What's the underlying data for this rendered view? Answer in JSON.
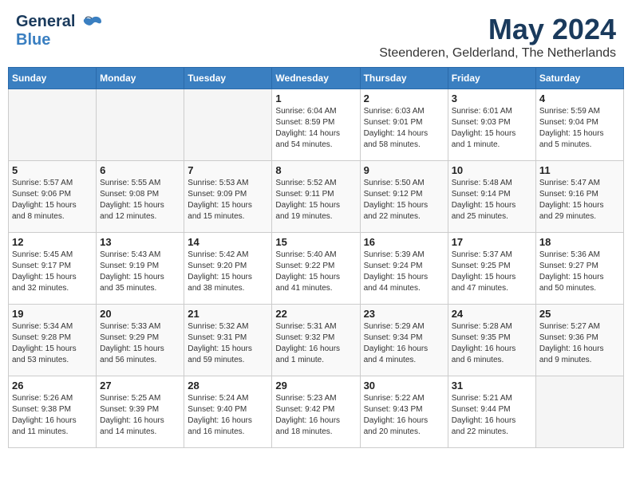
{
  "header": {
    "logo_general": "General",
    "logo_blue": "Blue",
    "title": "May 2024",
    "location": "Steenderen, Gelderland, The Netherlands"
  },
  "weekdays": [
    "Sunday",
    "Monday",
    "Tuesday",
    "Wednesday",
    "Thursday",
    "Friday",
    "Saturday"
  ],
  "weeks": [
    [
      {
        "day": "",
        "info": ""
      },
      {
        "day": "",
        "info": ""
      },
      {
        "day": "",
        "info": ""
      },
      {
        "day": "1",
        "info": "Sunrise: 6:04 AM\nSunset: 8:59 PM\nDaylight: 14 hours\nand 54 minutes."
      },
      {
        "day": "2",
        "info": "Sunrise: 6:03 AM\nSunset: 9:01 PM\nDaylight: 14 hours\nand 58 minutes."
      },
      {
        "day": "3",
        "info": "Sunrise: 6:01 AM\nSunset: 9:03 PM\nDaylight: 15 hours\nand 1 minute."
      },
      {
        "day": "4",
        "info": "Sunrise: 5:59 AM\nSunset: 9:04 PM\nDaylight: 15 hours\nand 5 minutes."
      }
    ],
    [
      {
        "day": "5",
        "info": "Sunrise: 5:57 AM\nSunset: 9:06 PM\nDaylight: 15 hours\nand 8 minutes."
      },
      {
        "day": "6",
        "info": "Sunrise: 5:55 AM\nSunset: 9:08 PM\nDaylight: 15 hours\nand 12 minutes."
      },
      {
        "day": "7",
        "info": "Sunrise: 5:53 AM\nSunset: 9:09 PM\nDaylight: 15 hours\nand 15 minutes."
      },
      {
        "day": "8",
        "info": "Sunrise: 5:52 AM\nSunset: 9:11 PM\nDaylight: 15 hours\nand 19 minutes."
      },
      {
        "day": "9",
        "info": "Sunrise: 5:50 AM\nSunset: 9:12 PM\nDaylight: 15 hours\nand 22 minutes."
      },
      {
        "day": "10",
        "info": "Sunrise: 5:48 AM\nSunset: 9:14 PM\nDaylight: 15 hours\nand 25 minutes."
      },
      {
        "day": "11",
        "info": "Sunrise: 5:47 AM\nSunset: 9:16 PM\nDaylight: 15 hours\nand 29 minutes."
      }
    ],
    [
      {
        "day": "12",
        "info": "Sunrise: 5:45 AM\nSunset: 9:17 PM\nDaylight: 15 hours\nand 32 minutes."
      },
      {
        "day": "13",
        "info": "Sunrise: 5:43 AM\nSunset: 9:19 PM\nDaylight: 15 hours\nand 35 minutes."
      },
      {
        "day": "14",
        "info": "Sunrise: 5:42 AM\nSunset: 9:20 PM\nDaylight: 15 hours\nand 38 minutes."
      },
      {
        "day": "15",
        "info": "Sunrise: 5:40 AM\nSunset: 9:22 PM\nDaylight: 15 hours\nand 41 minutes."
      },
      {
        "day": "16",
        "info": "Sunrise: 5:39 AM\nSunset: 9:24 PM\nDaylight: 15 hours\nand 44 minutes."
      },
      {
        "day": "17",
        "info": "Sunrise: 5:37 AM\nSunset: 9:25 PM\nDaylight: 15 hours\nand 47 minutes."
      },
      {
        "day": "18",
        "info": "Sunrise: 5:36 AM\nSunset: 9:27 PM\nDaylight: 15 hours\nand 50 minutes."
      }
    ],
    [
      {
        "day": "19",
        "info": "Sunrise: 5:34 AM\nSunset: 9:28 PM\nDaylight: 15 hours\nand 53 minutes."
      },
      {
        "day": "20",
        "info": "Sunrise: 5:33 AM\nSunset: 9:29 PM\nDaylight: 15 hours\nand 56 minutes."
      },
      {
        "day": "21",
        "info": "Sunrise: 5:32 AM\nSunset: 9:31 PM\nDaylight: 15 hours\nand 59 minutes."
      },
      {
        "day": "22",
        "info": "Sunrise: 5:31 AM\nSunset: 9:32 PM\nDaylight: 16 hours\nand 1 minute."
      },
      {
        "day": "23",
        "info": "Sunrise: 5:29 AM\nSunset: 9:34 PM\nDaylight: 16 hours\nand 4 minutes."
      },
      {
        "day": "24",
        "info": "Sunrise: 5:28 AM\nSunset: 9:35 PM\nDaylight: 16 hours\nand 6 minutes."
      },
      {
        "day": "25",
        "info": "Sunrise: 5:27 AM\nSunset: 9:36 PM\nDaylight: 16 hours\nand 9 minutes."
      }
    ],
    [
      {
        "day": "26",
        "info": "Sunrise: 5:26 AM\nSunset: 9:38 PM\nDaylight: 16 hours\nand 11 minutes."
      },
      {
        "day": "27",
        "info": "Sunrise: 5:25 AM\nSunset: 9:39 PM\nDaylight: 16 hours\nand 14 minutes."
      },
      {
        "day": "28",
        "info": "Sunrise: 5:24 AM\nSunset: 9:40 PM\nDaylight: 16 hours\nand 16 minutes."
      },
      {
        "day": "29",
        "info": "Sunrise: 5:23 AM\nSunset: 9:42 PM\nDaylight: 16 hours\nand 18 minutes."
      },
      {
        "day": "30",
        "info": "Sunrise: 5:22 AM\nSunset: 9:43 PM\nDaylight: 16 hours\nand 20 minutes."
      },
      {
        "day": "31",
        "info": "Sunrise: 5:21 AM\nSunset: 9:44 PM\nDaylight: 16 hours\nand 22 minutes."
      },
      {
        "day": "",
        "info": ""
      }
    ]
  ]
}
